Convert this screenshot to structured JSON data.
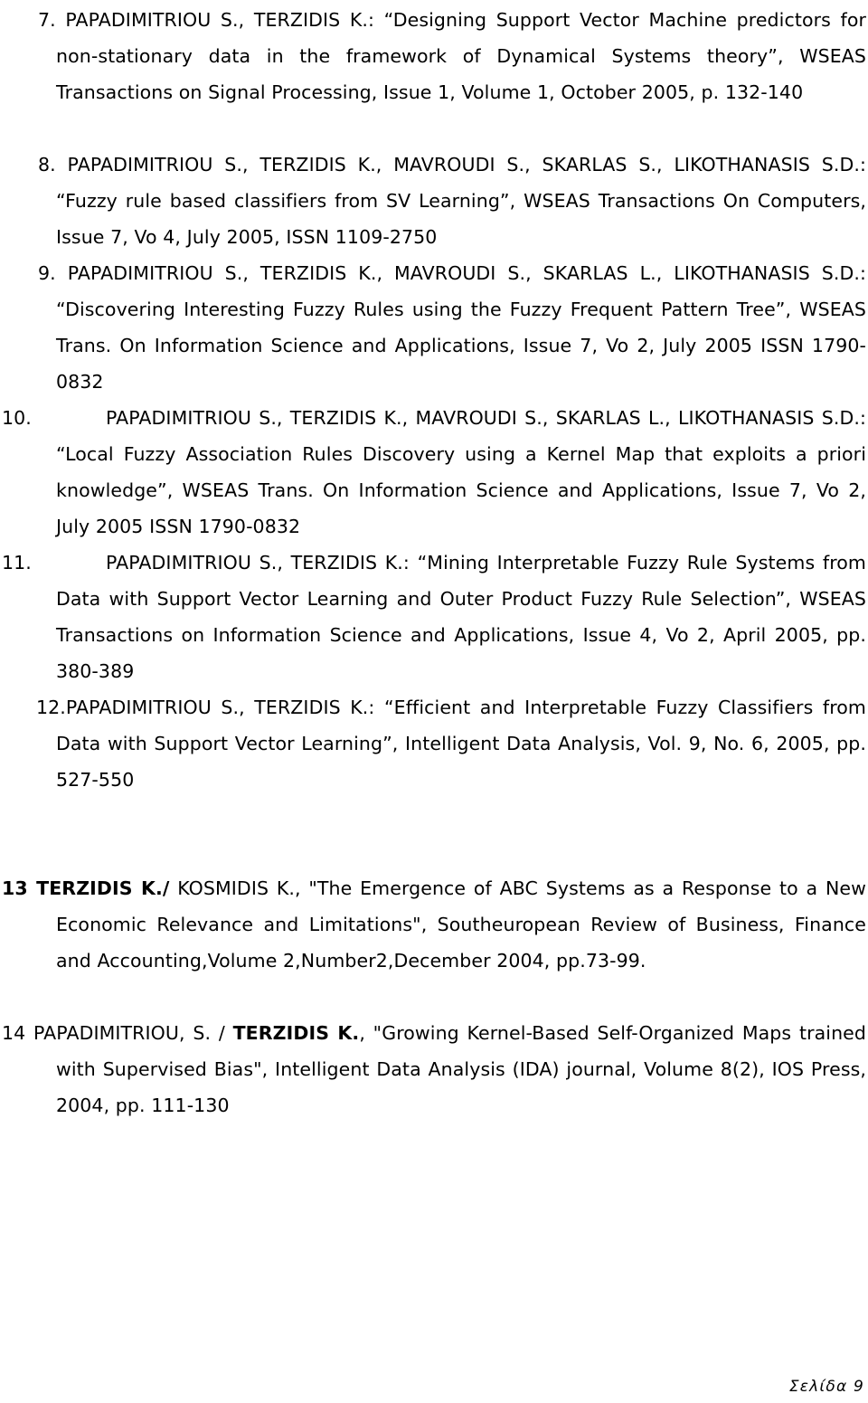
{
  "document": {
    "type": "reference-list",
    "page_label": "Σελίδα 9",
    "entries": [
      {
        "number": "7.",
        "style": "narrow",
        "text": "PAPADIMITRIOU S., TERZIDIS K.: “Designing Support Vector Machine predictors for non-stationary data in the framework of Dynamical Systems theory”, WSEAS Transactions on Signal Processing, Issue 1, Volume 1, October 2005, p. 132-140"
      },
      {
        "number": "8.",
        "style": "narrow",
        "text": "PAPADIMITRIOU S., TERZIDIS K., MAVROUDI S., SKARLAS S., LIKOTHANASIS S.D.: “Fuzzy rule based classifiers from SV Learning”, WSEAS Transactions On Computers, Issue 7, Vo 4, July 2005, ISSN 1109-2750"
      },
      {
        "number": "9.",
        "style": "narrow",
        "text": "PAPADIMITRIOU S., TERZIDIS K., MAVROUDI S., SKARLAS L., LIKOTHANASIS S.D.: “Discovering Interesting Fuzzy Rules using the Fuzzy Frequent Pattern Tree”, WSEAS Trans. On Information Science and Applications, Issue 7, Vo 2, July 2005 ISSN 1790-0832"
      },
      {
        "number": "10.",
        "style": "wide",
        "text": "PAPADIMITRIOU S., TERZIDIS K., MAVROUDI S., SKARLAS L., LIKOTHANASIS S.D.: “Local Fuzzy Association Rules Discovery using a Kernel Map that exploits a priori knowledge”, WSEAS Trans. On Information Science and Applications, Issue 7, Vo 2, July 2005 ISSN 1790-0832"
      },
      {
        "number": "11.",
        "style": "wide",
        "text": "PAPADIMITRIOU S., TERZIDIS K.: “Mining Interpretable Fuzzy Rule Systems from Data with Support Vector Learning and Outer Product Fuzzy Rule Selection”, WSEAS Transactions on Information Science and Applications, Issue 4, Vo 2, April 2005, pp. 380-389"
      },
      {
        "number": "12.",
        "style": "tight",
        "text": "PAPADIMITRIOU S., TERZIDIS K.: “Efficient and Interpretable Fuzzy Classifiers from Data with Support Vector Learning”, Intelligent Data Analysis, Vol. 9, No. 6, 2005, pp. 527-550"
      },
      {
        "number": "",
        "style": "flush",
        "bold_prefix": "13 TERZIDIS K./",
        "text": " KOSMIDIS K., \"The Emergence of ABC Systems as a Response to a New Economic Relevance and Limitations\",  Southeuropean Review of Business, Finance and Accounting,Volume 2,Number2,December 2004, pp.73-99."
      },
      {
        "number": "",
        "style": "flush",
        "lead_text": "14 PAPADIMITRIOU, S. / ",
        "bold_mid": "TERZIDIS K.",
        "text": ", \"Growing Kernel-Based Self-Organized Maps trained with Supervised Bias\", Intelligent Data Analysis (IDA) journal, Volume 8(2), IOS Press, 2004, pp. 111-130"
      }
    ]
  }
}
